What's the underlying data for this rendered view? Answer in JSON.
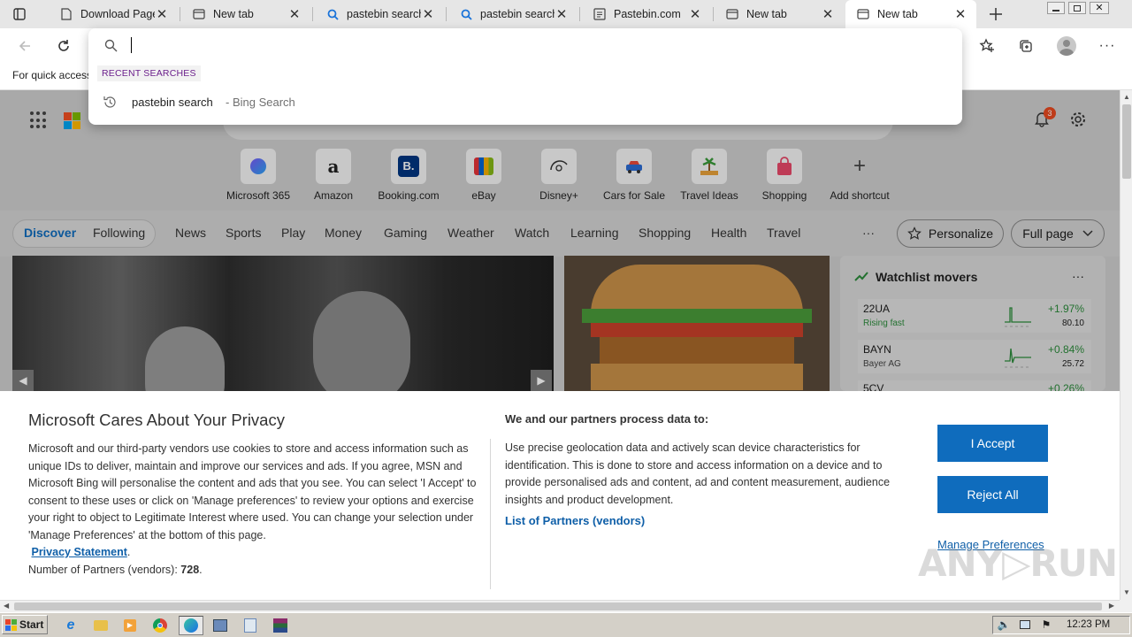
{
  "tabs": [
    {
      "label": "Download Page",
      "icon": "page-icon"
    },
    {
      "label": "New tab",
      "icon": "newtab-icon"
    },
    {
      "label": "pastebin search",
      "icon": "search-icon"
    },
    {
      "label": "pastebin search",
      "icon": "search-icon"
    },
    {
      "label": "Pastebin.com",
      "icon": "pastebin-icon"
    },
    {
      "label": "New tab",
      "icon": "newtab-icon"
    },
    {
      "label": "New tab",
      "icon": "newtab-icon",
      "active": true
    }
  ],
  "favbar": {
    "text": "For quick access"
  },
  "omnibox": {
    "input_value": "",
    "section_title": "RECENT SEARCHES",
    "suggestion_query": "pastebin search",
    "suggestion_source": "- Bing Search"
  },
  "header": {
    "notification_count": "3"
  },
  "shortcuts": [
    "Microsoft 365",
    "Amazon",
    "Booking.com",
    "eBay",
    "Disney+",
    "Cars for Sale",
    "Travel Ideas",
    "Shopping",
    "Add shortcut"
  ],
  "feed_nav": {
    "items": [
      "Discover",
      "Following",
      "News",
      "Sports",
      "Play",
      "Money",
      "Gaming",
      "Weather",
      "Watch",
      "Learning",
      "Shopping",
      "Health",
      "Travel"
    ],
    "more": "···",
    "personalize": "Personalize",
    "full_page": "Full page"
  },
  "watchlist": {
    "title": "Watchlist movers",
    "more": "···",
    "items": [
      {
        "symbol": "22UA",
        "sub": "Rising fast",
        "change": "+1.97%",
        "price": "80.10"
      },
      {
        "symbol": "BAYN",
        "sub": "Bayer AG",
        "change": "+0.84%",
        "price": "25.72"
      },
      {
        "symbol": "5CV",
        "sub": "",
        "change": "+0.26%",
        "price": ""
      }
    ]
  },
  "consent": {
    "title": "Microsoft Cares About Your Privacy",
    "body": "Microsoft and our third-party vendors use cookies to store and access information such as unique IDs to deliver, maintain and improve our services and ads. If you agree, MSN and Microsoft Bing will personalise the content and ads that you see. You can select 'I Accept' to consent to these uses or click on 'Manage preferences' to review your options and exercise your right to object to Legitimate Interest where used.  You can change your selection under 'Manage Preferences' at the bottom of this page.",
    "privacy_link": "Privacy Statement",
    "partners_label": "Number of Partners (vendors):",
    "partners_count": "728",
    "right_title": "We and our partners process data to:",
    "right_body": "Use precise geolocation data and actively scan device characteristics for identification. This is done to store and access information on a device and to provide personalised ads and content, ad and content measurement, audience insights and product development.",
    "partners_link": "List of Partners (vendors)",
    "accept": "I Accept",
    "reject": "Reject All",
    "manage": "Manage Preferences"
  },
  "taskbar": {
    "start": "Start",
    "clock": "12:23 PM"
  },
  "colors": {
    "accent": "#0f6cbd",
    "link": "#0f5fa8",
    "badge": "#e84a20"
  }
}
